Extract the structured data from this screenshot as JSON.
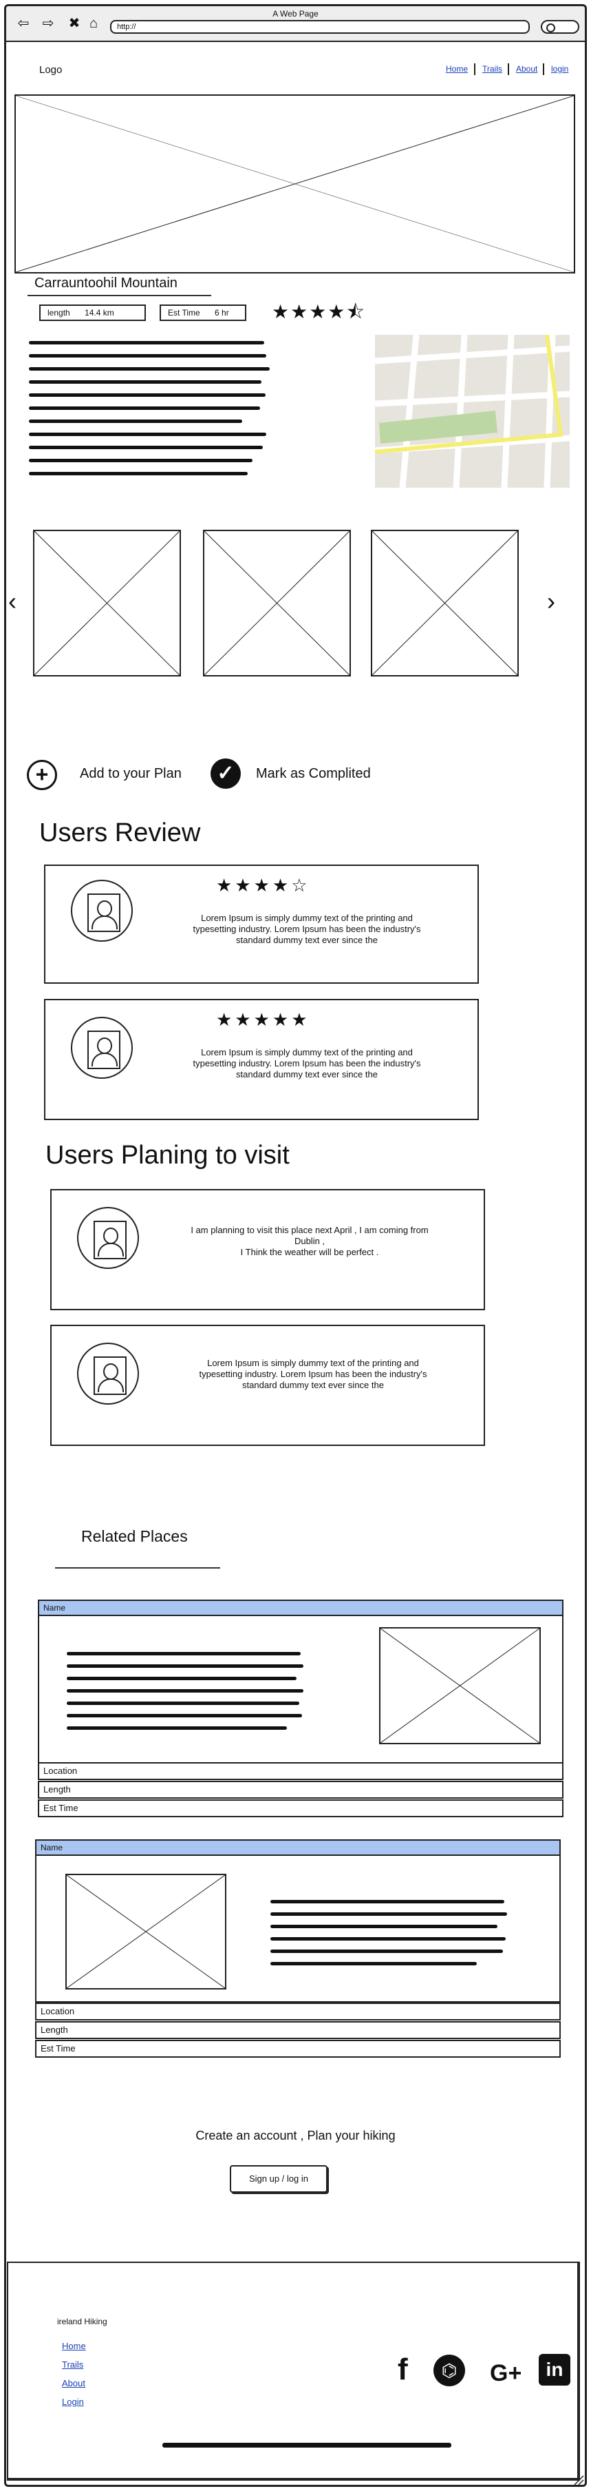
{
  "browser": {
    "title": "A Web Page",
    "url": "http://",
    "back_glyph": "⇦",
    "forward_glyph": "⇨",
    "close_glyph": "✖",
    "home_glyph": "⌂"
  },
  "header": {
    "logo": "Logo",
    "nav": [
      "Home",
      "Trails",
      "About",
      "login"
    ]
  },
  "mountain": {
    "title": "Carrauntoohil Mountain",
    "length_label": "length",
    "length_value": "14.4 km",
    "time_label": "Est Time",
    "time_value": "6 hr",
    "rating_stars": "★★★★⯪"
  },
  "gallery": {
    "prev": "‹",
    "next": "›"
  },
  "actions": {
    "add_icon": "+",
    "add_label": "Add to your Plan",
    "check_icon": "✓",
    "complete_label": "Mark as Complited"
  },
  "reviews": {
    "heading": "Users Review",
    "items": [
      {
        "stars": "★★★★☆",
        "text": "Lorem Ipsum is simply dummy text of the printing and typesetting industry. Lorem Ipsum has been the industry's standard dummy text ever since the"
      },
      {
        "stars": "★★★★★",
        "text": "Lorem Ipsum is simply dummy text of the printing and typesetting industry. Lorem Ipsum has been the industry's standard dummy text ever since the"
      }
    ]
  },
  "visitors": {
    "heading": "Users Planing to visit",
    "items": [
      {
        "text": "I am planning to visit this place next April , I am coming from Dublin ,\nI Think the weather will be perfect ."
      },
      {
        "text": "Lorem Ipsum is simply dummy text of the printing and typesetting industry. Lorem Ipsum has been the industry's standard dummy text ever since the"
      }
    ]
  },
  "related": {
    "heading": "Related Places",
    "cards": [
      {
        "name": "Name",
        "location": "Location",
        "length": "Length",
        "time": "Est Time"
      },
      {
        "name": "Name",
        "location": "Location",
        "length": "Length",
        "time": "Est Time"
      }
    ]
  },
  "cta": {
    "text": "Create an account , Plan your hiking",
    "button": "Sign up / log in"
  },
  "footer": {
    "brand": "ireland Hiking",
    "links": [
      "Home",
      "Trails",
      "About",
      "Login"
    ],
    "social": {
      "facebook": "f",
      "github": "⌬",
      "google": "G+",
      "linkedin": "in"
    }
  }
}
